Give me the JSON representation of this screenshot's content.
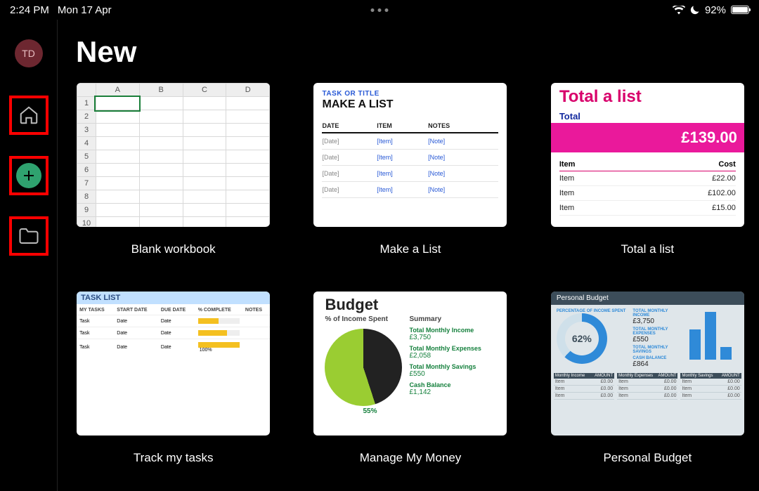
{
  "status": {
    "time": "2:24 PM",
    "date": "Mon 17 Apr",
    "battery_pct": "92%"
  },
  "avatar": "TD",
  "title": "New",
  "templates": [
    {
      "label": "Blank workbook"
    },
    {
      "label": "Make a List"
    },
    {
      "label": "Total a list"
    },
    {
      "label": "Track my tasks"
    },
    {
      "label": "Manage My Money"
    },
    {
      "label": "Personal Budget"
    }
  ],
  "blank": {
    "cols": [
      "",
      "A",
      "B",
      "C",
      "D"
    ],
    "rows": [
      "1",
      "2",
      "3",
      "4",
      "5",
      "6",
      "7",
      "8",
      "9",
      "10"
    ]
  },
  "makeList": {
    "sub": "TASK OR TITLE",
    "heading": "MAKE A LIST",
    "cols": [
      "DATE",
      "ITEM",
      "NOTES"
    ],
    "rows": [
      [
        "[Date]",
        "[Item]",
        "[Note]"
      ],
      [
        "[Date]",
        "[Item]",
        "[Note]"
      ],
      [
        "[Date]",
        "[Item]",
        "[Note]"
      ],
      [
        "[Date]",
        "[Item]",
        "[Note]"
      ]
    ]
  },
  "totalList": {
    "heading": "Total a list",
    "totalLabel": "Total",
    "totalValue": "£139.00",
    "cols": [
      "Item",
      "Cost"
    ],
    "rows": [
      [
        "Item",
        "£22.00"
      ],
      [
        "Item",
        "£102.00"
      ],
      [
        "Item",
        "£15.00"
      ]
    ]
  },
  "tasks": {
    "heading": "TASK LIST",
    "cols": [
      "MY TASKS",
      "START DATE",
      "DUE DATE",
      "% COMPLETE",
      "NOTES"
    ],
    "rows": [
      {
        "c": [
          "Task",
          "Date",
          "Date"
        ],
        "pct": 50
      },
      {
        "c": [
          "Task",
          "Date",
          "Date"
        ],
        "pct": 70
      },
      {
        "c": [
          "Task",
          "Date",
          "Date"
        ],
        "pct": 100,
        "label": "100%"
      }
    ]
  },
  "money": {
    "heading": "Budget",
    "sub": "% of Income Spent",
    "summary": "Summary",
    "pct": "55%",
    "items": [
      [
        "Total Monthly Income",
        "£3,750"
      ],
      [
        "Total Monthly Expenses",
        "£2,058"
      ],
      [
        "Total Monthly Savings",
        "£550"
      ],
      [
        "Cash Balance",
        "£1,142"
      ]
    ]
  },
  "personal": {
    "heading": "Personal Budget",
    "pct": "62%",
    "stats": [
      [
        "PERCENTAGE OF INCOME SPENT",
        ""
      ],
      [
        "TOTAL MONTHLY INCOME",
        "£3,750"
      ],
      [
        "TOTAL MONTHLY EXPENSES",
        "£550"
      ],
      [
        "TOTAL MONTHLY SAVINGS",
        ""
      ],
      [
        "CASH BALANCE",
        "£864"
      ]
    ],
    "tables": [
      "Monthly Income",
      "Monthly Expenses",
      "Monthly Savings"
    ]
  }
}
